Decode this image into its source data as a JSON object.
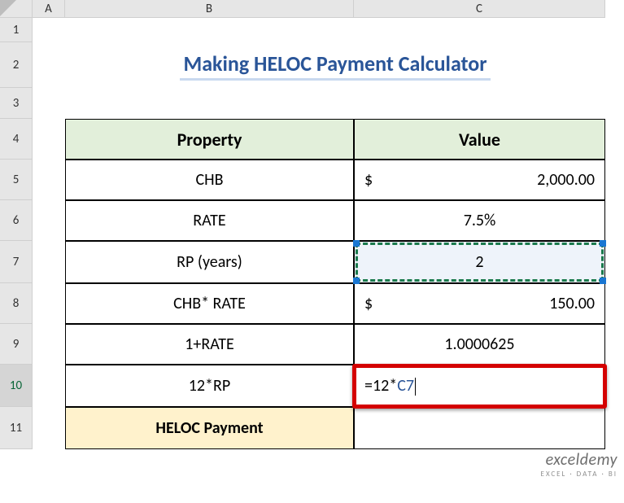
{
  "columns": {
    "blank": "",
    "A": "A",
    "B": "B",
    "C": "C"
  },
  "rows": {
    "r1": "1",
    "r2": "2",
    "r3": "3",
    "r4": "4",
    "r5": "5",
    "r6": "6",
    "r7": "7",
    "r8": "8",
    "r9": "9",
    "r10": "10",
    "r11": "11"
  },
  "title": "Making HELOC Payment Calculator",
  "headers": {
    "property": "Property",
    "value": "Value"
  },
  "table": {
    "r5": {
      "label": "CHB",
      "currency_symbol": "$",
      "value": "2,000.00"
    },
    "r6": {
      "label": "RATE",
      "value": "7.5%"
    },
    "r7": {
      "label": "RP (years)",
      "value": "2"
    },
    "r8": {
      "label": "CHB* RATE",
      "currency_symbol": "$",
      "value": "150.00"
    },
    "r9": {
      "label": "1+RATE",
      "value": "1.0000625"
    },
    "r10": {
      "label": "12*RP",
      "formula_prefix": "=12*",
      "formula_ref": "C7"
    },
    "r11": {
      "label": "HELOC Payment",
      "value": ""
    }
  },
  "watermark": {
    "line1": "exceldemy",
    "line2": "EXCEL · DATA · BI"
  }
}
